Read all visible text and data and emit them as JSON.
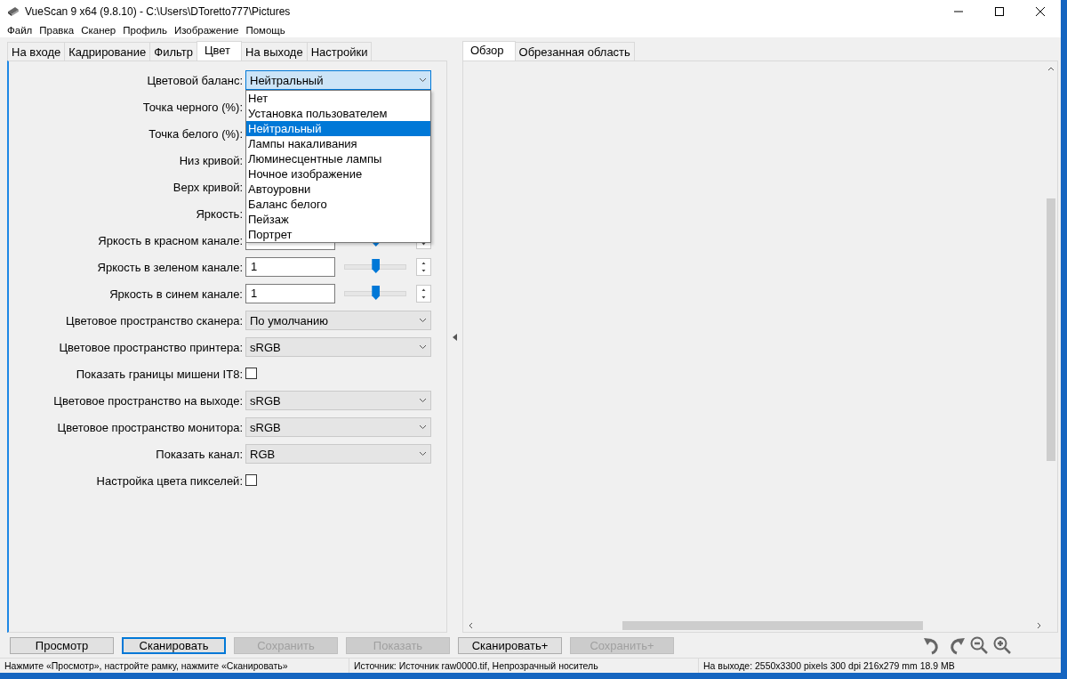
{
  "window": {
    "title": "VueScan 9 x64 (9.8.10) - C:\\Users\\DToretto777\\Pictures"
  },
  "menu": [
    "Файл",
    "Правка",
    "Сканер",
    "Профиль",
    "Изображение",
    "Помощь"
  ],
  "tabs": [
    {
      "label": "На входе",
      "selected": false
    },
    {
      "label": "Кадрирование",
      "selected": false
    },
    {
      "label": "Фильтр",
      "selected": false
    },
    {
      "label": "Цвет",
      "selected": true
    },
    {
      "label": "На выходе",
      "selected": false
    },
    {
      "label": "Настройки",
      "selected": false
    }
  ],
  "form": [
    {
      "kind": "combo",
      "label": "Цветовой баланс:",
      "value": "Нейтральный",
      "expanded": true,
      "options": [
        {
          "label": "Нет",
          "selected": false
        },
        {
          "label": "Установка пользователем",
          "selected": false
        },
        {
          "label": "Нейтральный",
          "selected": true
        },
        {
          "label": "Лампы накаливания",
          "selected": false
        },
        {
          "label": "Люминесцентные лампы",
          "selected": false
        },
        {
          "label": "Ночное изображение",
          "selected": false
        },
        {
          "label": "Автоуровни",
          "selected": false
        },
        {
          "label": "Баланс белого",
          "selected": false
        },
        {
          "label": "Пейзаж",
          "selected": false
        },
        {
          "label": "Портрет",
          "selected": false
        }
      ]
    },
    {
      "kind": "covered",
      "label": "Точка черного (%):"
    },
    {
      "kind": "covered",
      "label": "Точка белого (%):"
    },
    {
      "kind": "covered",
      "label": "Низ кривой:"
    },
    {
      "kind": "covered",
      "label": "Верх кривой:"
    },
    {
      "kind": "covered",
      "label": "Яркость:"
    },
    {
      "kind": "slider",
      "label": "Яркость в красном канале:",
      "level": 0.5
    },
    {
      "kind": "slider",
      "label": "Яркость в зеленом канале:",
      "value": "1",
      "level": 0.5
    },
    {
      "kind": "slider",
      "label": "Яркость в синем канале:",
      "value": "1",
      "level": 0.5
    },
    {
      "kind": "select",
      "label": "Цветовое пространство сканера:",
      "value": "По умолчанию"
    },
    {
      "kind": "select",
      "label": "Цветовое пространство принтера:",
      "value": "sRGB"
    },
    {
      "kind": "check",
      "label": "Показать границы мишени IT8:",
      "checked": false
    },
    {
      "kind": "select",
      "label": "Цветовое пространство на выходе:",
      "value": "sRGB"
    },
    {
      "kind": "select",
      "label": "Цветовое пространство монитора:",
      "value": "sRGB"
    },
    {
      "kind": "select",
      "label": "Показать канал:",
      "value": "RGB"
    },
    {
      "kind": "check",
      "label": "Настройка цвета пикселей:",
      "checked": false
    }
  ],
  "preview_tabs": [
    {
      "label": "Обзор",
      "selected": true
    },
    {
      "label": "Обрезанная область",
      "selected": false
    }
  ],
  "buttons": [
    {
      "label": "Просмотр",
      "disabled": false,
      "focused": false
    },
    {
      "label": "Сканировать",
      "disabled": false,
      "focused": true
    },
    {
      "label": "Сохранить",
      "disabled": true,
      "focused": false
    },
    {
      "label": "Показать",
      "disabled": true,
      "focused": false
    },
    {
      "label": "Сканировать+",
      "disabled": false,
      "focused": false
    },
    {
      "label": "Сохранить+",
      "disabled": true,
      "focused": false
    }
  ],
  "status_bar": [
    "Нажмите «Просмотр», настройте рамку, нажмите «Сканировать»",
    "Источник: Источник raw0000.tif, Непрозрачный носитель",
    "На выходе: 2550x3300 pixels 300 dpi 216x279 mm 18.9 MB"
  ]
}
